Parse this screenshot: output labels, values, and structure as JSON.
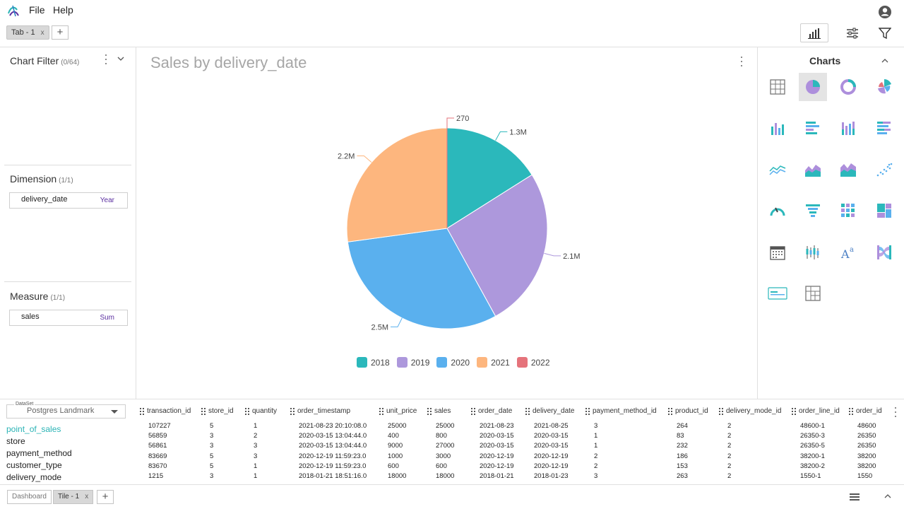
{
  "menu": {
    "file": "File",
    "help": "Help"
  },
  "tabs": {
    "tab1": "Tab - 1",
    "close": "x",
    "add": "+"
  },
  "toolbar": {
    "icons": [
      "bar-chart-icon",
      "sliders-icon",
      "filter-icon"
    ]
  },
  "left_panel": {
    "chart_filter": {
      "title": "Chart Filter",
      "count": "(0/64)"
    },
    "dimension": {
      "title": "Dimension",
      "count": "(1/1)",
      "field": "delivery_date",
      "agg": "Year"
    },
    "measure": {
      "title": "Measure",
      "count": "(1/1)",
      "field": "sales",
      "agg": "Sum"
    }
  },
  "chart": {
    "title": "Sales by delivery_date"
  },
  "chart_data": {
    "type": "pie",
    "title": "Sales by delivery_date",
    "categories": [
      "2018",
      "2019",
      "2020",
      "2021",
      "2022"
    ],
    "values": [
      1300000,
      2100000,
      2500000,
      2200000,
      270
    ],
    "data_labels": [
      "1.3M",
      "2.1M",
      "2.5M",
      "2.2M",
      "270"
    ],
    "colors": [
      "#2bb8bb",
      "#ad98dc",
      "#5ab0ee",
      "#fdb67e",
      "#e5737b"
    ],
    "legend_position": "bottom"
  },
  "right_panel": {
    "title": "Charts",
    "chart_types": [
      "table-chart-icon",
      "pie-chart-icon",
      "donut-chart-icon",
      "rose-chart-icon",
      "column-chart-icon",
      "bar-chart-horizontal-icon",
      "stacked-column-chart-icon",
      "stacked-bar-chart-icon",
      "line-chart-icon",
      "area-chart-icon",
      "stacked-area-chart-icon",
      "scatter-chart-icon",
      "gauge-chart-icon",
      "funnel-chart-icon",
      "heatmap-chart-icon",
      "treemap-chart-icon",
      "calendar-chart-icon",
      "boxplot-chart-icon",
      "rich-text-icon",
      "sankey-chart-icon",
      "card-chart-icon",
      "pivot-table-icon"
    ],
    "selected": "pie-chart-icon"
  },
  "datasource": {
    "label": "DataSet",
    "selected": "Postgres Landmark",
    "tables": [
      "point_of_sales",
      "store",
      "payment_method",
      "customer_type",
      "delivery_mode"
    ],
    "active_table": "point_of_sales"
  },
  "grid": {
    "columns": [
      "transaction_id",
      "store_id",
      "quantity",
      "order_timestamp",
      "unit_price",
      "sales",
      "order_date",
      "delivery_date",
      "payment_method_id",
      "product_id",
      "delivery_mode_id",
      "order_line_id",
      "order_id"
    ],
    "rows": [
      [
        "107227",
        "5",
        "1",
        "2021-08-23 20:10:08.0",
        "25000",
        "25000",
        "2021-08-23",
        "2021-08-25",
        "3",
        "264",
        "2",
        "48600-1",
        "48600"
      ],
      [
        "56859",
        "3",
        "2",
        "2020-03-15 13:04:44.0",
        "400",
        "800",
        "2020-03-15",
        "2020-03-15",
        "1",
        "83",
        "2",
        "26350-3",
        "26350"
      ],
      [
        "56861",
        "3",
        "3",
        "2020-03-15 13:04:44.0",
        "9000",
        "27000",
        "2020-03-15",
        "2020-03-15",
        "1",
        "232",
        "2",
        "26350-5",
        "26350"
      ],
      [
        "83669",
        "5",
        "3",
        "2020-12-19 11:59:23.0",
        "1000",
        "3000",
        "2020-12-19",
        "2020-12-19",
        "2",
        "186",
        "2",
        "38200-1",
        "38200"
      ],
      [
        "83670",
        "5",
        "1",
        "2020-12-19 11:59:23.0",
        "600",
        "600",
        "2020-12-19",
        "2020-12-19",
        "2",
        "153",
        "2",
        "38200-2",
        "38200"
      ],
      [
        "1215",
        "3",
        "1",
        "2018-01-21 18:51:16.0",
        "18000",
        "18000",
        "2018-01-21",
        "2018-01-23",
        "3",
        "263",
        "2",
        "1550-1",
        "1550"
      ]
    ]
  },
  "footer": {
    "dashboard": "Dashboard",
    "tile": "Tile - 1",
    "close": "x",
    "add": "+"
  }
}
